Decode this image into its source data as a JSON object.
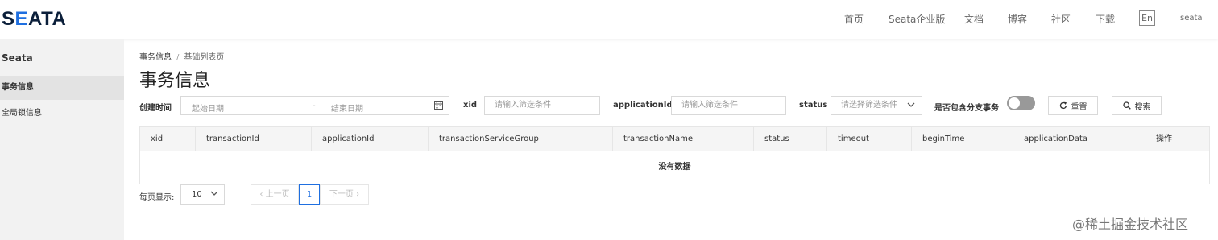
{
  "header": {
    "logo_text": "SEATA",
    "nav": [
      "首页",
      "Seata企业版",
      "文档",
      "博客",
      "社区",
      "下载"
    ],
    "lang": "En",
    "user": "seata"
  },
  "sidebar": {
    "title": "Seata",
    "items": [
      {
        "label": "事务信息",
        "active": true
      },
      {
        "label": "全局锁信息",
        "active": false
      }
    ]
  },
  "breadcrumb": {
    "parent": "事务信息",
    "separator": "/",
    "current": "基础列表页"
  },
  "page_title": "事务信息",
  "filters": {
    "create_time_label": "创建时间",
    "start_placeholder": "起始日期",
    "range_sep": "-",
    "end_placeholder": "结束日期",
    "xid_label": "xid",
    "xid_placeholder": "请输入筛选条件",
    "app_label": "applicationId",
    "app_placeholder": "请输入筛选条件",
    "status_label": "status",
    "status_placeholder": "请选择筛选条件",
    "branch_label": "是否包含分支事务",
    "branch_on": false,
    "reset_label": "重置",
    "search_label": "搜索"
  },
  "table": {
    "columns": [
      "xid",
      "transactionId",
      "applicationId",
      "transactionServiceGroup",
      "transactionName",
      "status",
      "timeout",
      "beginTime",
      "applicationData",
      "操作"
    ],
    "empty_text": "没有数据"
  },
  "pagination": {
    "page_size_label": "每页显示:",
    "page_size": "10",
    "prev": "上一页",
    "current": "1",
    "next": "下一页"
  },
  "watermark": "@稀土掘金技术社区",
  "colors": {
    "accent": "#1f6fe0"
  }
}
